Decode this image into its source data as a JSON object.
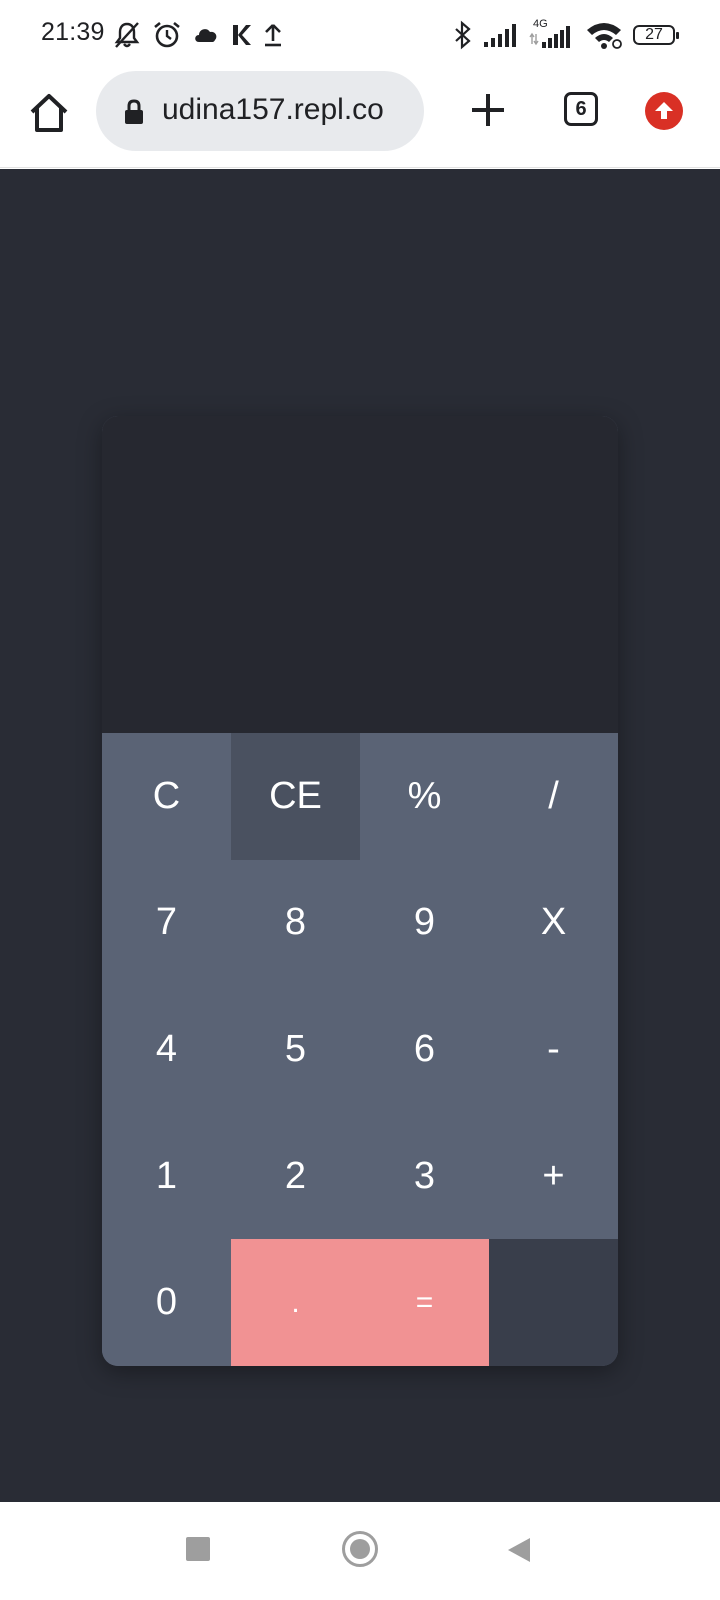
{
  "status_bar": {
    "time": "21:39",
    "left_icons": [
      "mute-icon",
      "alarm-icon",
      "cloud-icon",
      "k-app-icon",
      "upload-icon"
    ],
    "right_icons": [
      "bluetooth-icon",
      "signal-icon",
      "4g-signal-icon",
      "wifi-icon"
    ],
    "network_label": "4G",
    "battery": "27"
  },
  "browser": {
    "url": "udina157.repl.co",
    "tab_count": "6",
    "update_color": "#d93025"
  },
  "calculator": {
    "display_value": "",
    "keys": [
      {
        "label": "C",
        "name": "clear-key"
      },
      {
        "label": "CE",
        "name": "clear-entry-key"
      },
      {
        "label": "%",
        "name": "percent-key"
      },
      {
        "label": "/",
        "name": "divide-key"
      },
      {
        "label": "7",
        "name": "digit-7-key"
      },
      {
        "label": "8",
        "name": "digit-8-key"
      },
      {
        "label": "9",
        "name": "digit-9-key"
      },
      {
        "label": "X",
        "name": "multiply-key"
      },
      {
        "label": "4",
        "name": "digit-4-key"
      },
      {
        "label": "5",
        "name": "digit-5-key"
      },
      {
        "label": "6",
        "name": "digit-6-key"
      },
      {
        "label": "-",
        "name": "subtract-key"
      },
      {
        "label": "1",
        "name": "digit-1-key"
      },
      {
        "label": "2",
        "name": "digit-2-key"
      },
      {
        "label": "3",
        "name": "digit-3-key"
      },
      {
        "label": "+",
        "name": "add-key"
      },
      {
        "label": "0",
        "name": "digit-0-key"
      },
      {
        "label": ".",
        "name": "decimal-key"
      },
      {
        "label": "=",
        "name": "equals-key"
      },
      {
        "label": "",
        "name": "blank-key"
      }
    ],
    "colors": {
      "background": "#292c35",
      "display": "#262830",
      "key": "#5a6375",
      "key_pressed": "#4a5160",
      "accent": "#f19293",
      "dark_key": "#393e4b"
    }
  },
  "nav_bar": {
    "icons": [
      "recent-apps-icon",
      "home-icon",
      "back-icon"
    ]
  }
}
